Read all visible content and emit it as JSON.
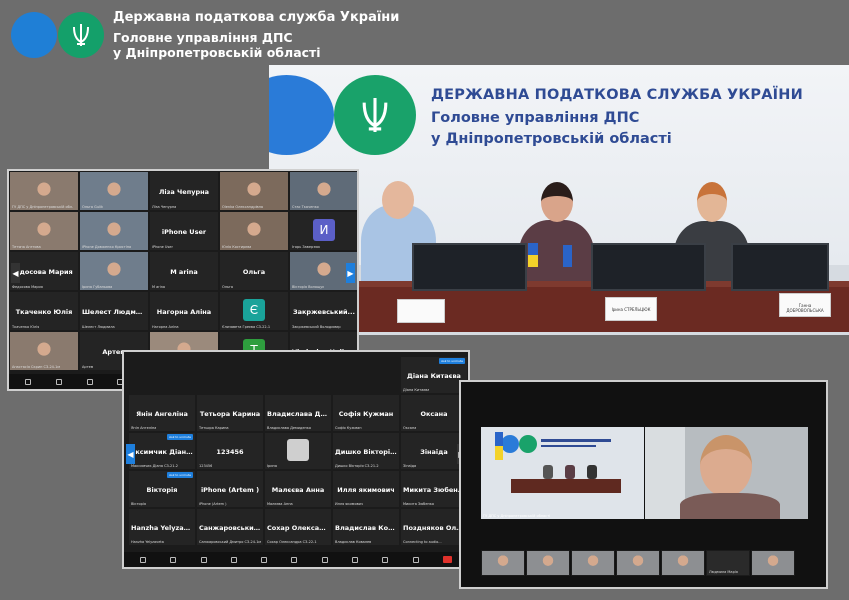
{
  "header": {
    "line1": "Державна податкова служба України",
    "line2": "Головне управління ДПС",
    "line3": "у Дніпропетровській області"
  },
  "photo": {
    "wall_line1": "ДЕРЖАВНА ПОДАТКОВА СЛУЖБА УКРАЇНИ",
    "wall_line2": "Головне управління ДПС",
    "wall_line3": "у Дніпропетровській області",
    "nameplates": [
      "",
      "Ірина СТРЕЛЬЦЮК",
      "Ганна ДОБРОВОЛЬСЬКА"
    ]
  },
  "colors": {
    "accent_blue": "#1f7fd6",
    "accent_green": "#14a06a",
    "background": "#6d6d6d",
    "zoom_end": "#e0312b"
  },
  "zoom1": {
    "tiles": [
      {
        "name": "",
        "sub": "ГУ ДПС у Дніпропетровській обл.",
        "video": true
      },
      {
        "name": "",
        "sub": "Ольга Gulik",
        "video": true
      },
      {
        "name": "Ліза Чепурна",
        "sub": "Ліза Чепурна",
        "video": false
      },
      {
        "name": "",
        "sub": "Оlenka Олександрівна",
        "video": true
      },
      {
        "name": "",
        "sub": "Стас Ткаченко",
        "video": true
      },
      {
        "name": "",
        "sub": "Тетяна Агетова",
        "video": true
      },
      {
        "name": "",
        "sub": "iPhone Довженко Кристіна",
        "video": true
      },
      {
        "name": "iPhone User",
        "sub": "iPhone User",
        "video": false
      },
      {
        "name": "",
        "sub": "Юлія Костирєва",
        "video": true
      },
      {
        "name": "",
        "sub": "Ігорь Заверзюк",
        "avatar": "И",
        "avatar_color": "#5b5fc7"
      },
      {
        "name": "едосова Мария",
        "sub": "Федосова Мария",
        "video": false
      },
      {
        "name": "",
        "sub": "Ірина Губаньова",
        "video": true
      },
      {
        "name": "M arina",
        "sub": "M arina",
        "video": false
      },
      {
        "name": "Ольга",
        "sub": "Ольга",
        "video": false
      },
      {
        "name": "",
        "sub": "Вікторія Волощук",
        "video": true
      },
      {
        "name": "Ткаченко Юлія",
        "sub": "Ткаченко Юлія",
        "video": false
      },
      {
        "name": "Шелест Людми...",
        "sub": "Шелест Людмила",
        "video": false
      },
      {
        "name": "Нагорна Аліна",
        "sub": "Нагорна Аліна",
        "video": false
      },
      {
        "name": "",
        "sub": "Єлизавета Греєва СЗ-22-1",
        "avatar": "Є",
        "avatar_color": "#1aa39a"
      },
      {
        "name": "Закржевський...",
        "sub": "Закржевський Володимир",
        "video": false
      },
      {
        "name": "",
        "sub": "Анастасія Скрип СЗ-24-1м",
        "video": true
      },
      {
        "name": "Артем",
        "sub": "Артем",
        "video": false
      },
      {
        "name": "",
        "sub": "Sabinahashimovahashimova",
        "video": true
      },
      {
        "name": "",
        "sub": "Тамік Лукаенко",
        "avatar": "T",
        "avatar_color": "#2e9e3e"
      },
      {
        "name": "Vladyslav Hulivets",
        "sub": "Vladyslav Hulivets",
        "video": false
      }
    ]
  },
  "zoom2": {
    "tiles": [
      {
        "name": "Діана Китаєва",
        "sub": "Діана Китаєва"
      },
      {
        "name": "Янін Ангеліна",
        "sub": "Янін Ангеліна"
      },
      {
        "name": "Тетьора Карина",
        "sub": "Тетьора Карина"
      },
      {
        "name": "Владислава Де...",
        "sub": "Владислава Демиденко"
      },
      {
        "name": "Софія Кужман",
        "sub": "Софія Кужман"
      },
      {
        "name": "Оксана",
        "sub": "Оксана"
      },
      {
        "name": "аксимчик Діан...",
        "sub": "Максимчик Діана СЗ-21-2"
      },
      {
        "name": "123456",
        "sub": "123456"
      },
      {
        "name": "",
        "sub": "Ірина"
      },
      {
        "name": "Дишко Вікторія...",
        "sub": "Дишко Вікторія СЗ-21-2"
      },
      {
        "name": "Зінаїда",
        "sub": "Зінаїда"
      },
      {
        "name": "Вікторія",
        "sub": "Вікторія"
      },
      {
        "name": "iPhone (Artem )",
        "sub": "iPhone (Artem )"
      },
      {
        "name": "Малєєва Анна",
        "sub": "Малєєва Анна"
      },
      {
        "name": "Илля якимович",
        "sub": "Илля якимович"
      },
      {
        "name": "Микита Зюбенко",
        "sub": "Микита Зюбенко"
      },
      {
        "name": "Hanzha Yelyzav...",
        "sub": "Hanzha Yelyzaveta"
      },
      {
        "name": "Санжаровськи...",
        "sub": "Санжаровський Дмитро СЗ-24-1м"
      },
      {
        "name": "Сохар Олексан...",
        "sub": "Сохар Олександра СЗ-22-1"
      },
      {
        "name": "Владислав Ков...",
        "sub": "Владислав Ковалев"
      },
      {
        "name": "Поздняков Оле...",
        "sub": "Connecting to audio..."
      }
    ],
    "unmute_label": "Ask to unmute"
  },
  "zoom3": {
    "main_sub": "ГУ ДПС у Дніпропетровській області",
    "strip_sub": [
      "",
      "",
      "",
      "",
      "",
      "Людмила Марія",
      ""
    ]
  }
}
